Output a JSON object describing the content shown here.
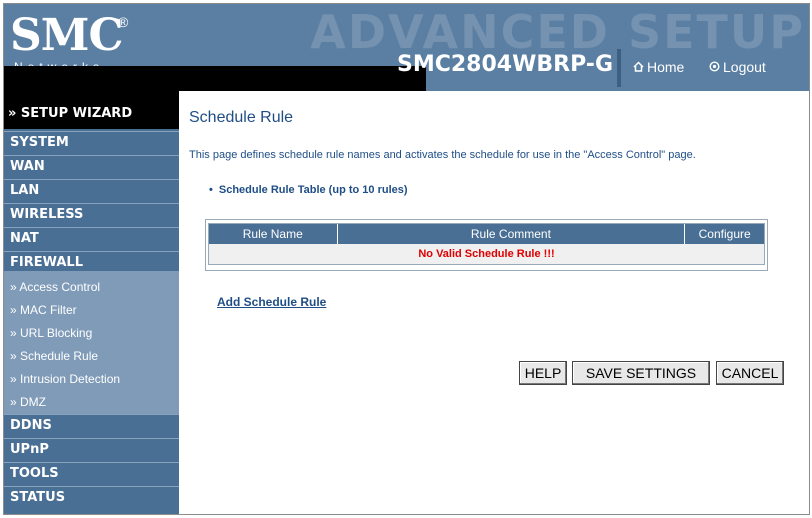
{
  "header": {
    "logo_text": "SMC",
    "logo_reg": "®",
    "logo_sub": "Networks",
    "banner": "ADVANCED SETUP",
    "model": "SMC2804WBRP-G",
    "nav": {
      "home_label": "Home",
      "logout_label": "Logout",
      "home_icon": "home-icon",
      "logout_icon": "power-icon"
    }
  },
  "sidebar": {
    "wizard_label": "» SETUP WIZARD",
    "items": [
      {
        "label": "SYSTEM"
      },
      {
        "label": "WAN"
      },
      {
        "label": "LAN"
      },
      {
        "label": "WIRELESS"
      },
      {
        "label": "NAT"
      },
      {
        "label": "FIREWALL"
      }
    ],
    "subitems": [
      {
        "label": "» Access Control"
      },
      {
        "label": "» MAC Filter"
      },
      {
        "label": "» URL Blocking"
      },
      {
        "label": "» Schedule Rule"
      },
      {
        "label": "» Intrusion Detection"
      },
      {
        "label": "» DMZ"
      }
    ],
    "items_after": [
      {
        "label": "DDNS"
      },
      {
        "label": "UPnP"
      },
      {
        "label": "TOOLS"
      },
      {
        "label": "STATUS"
      }
    ]
  },
  "main": {
    "title": "Schedule Rule",
    "description": "This page defines schedule rule names and activates the schedule for use in the \"Access Control\" page.",
    "bullet_text": "Schedule Rule Table (up to 10 rules)",
    "table": {
      "headers": [
        "Rule Name",
        "Rule Comment",
        "Configure"
      ],
      "empty_message": "No Valid Schedule Rule !!!"
    },
    "add_link": "Add Schedule Rule",
    "buttons": {
      "help": "HELP",
      "save": "SAVE SETTINGS",
      "cancel": "CANCEL"
    }
  },
  "colors": {
    "header_blue": "#5b7fa3",
    "sidebar_blue": "#4a6f95",
    "submenu_blue": "#7f9bb8",
    "title_blue": "#1f4e86",
    "error_red": "#e00000"
  }
}
